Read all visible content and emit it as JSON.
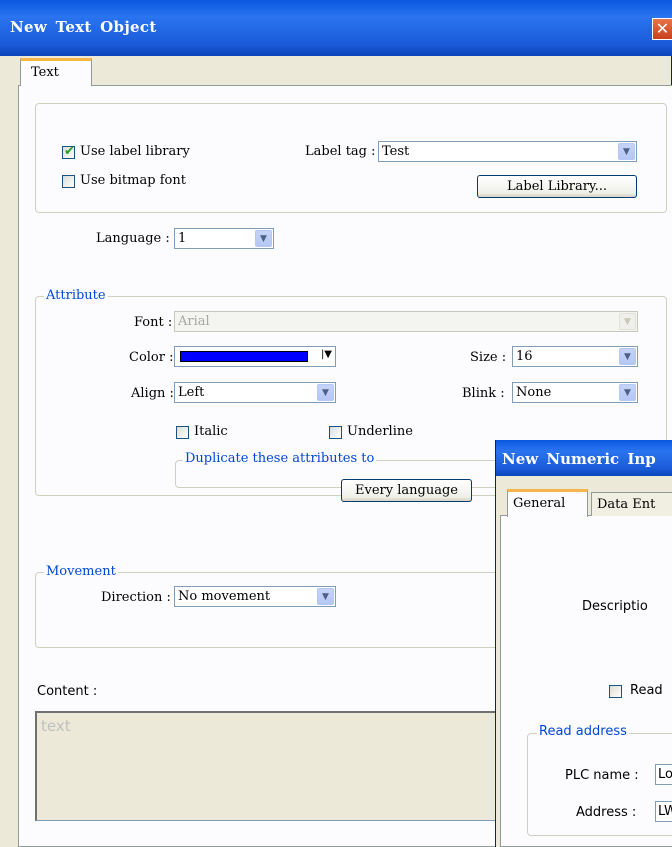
{
  "window": {
    "title": "New  Text Object",
    "close_glyph": "✕"
  },
  "tabs": [
    {
      "label": "Text"
    }
  ],
  "library": {
    "use_label_library": {
      "label": "Use label library",
      "checked": true
    },
    "use_bitmap_font": {
      "label": "Use bitmap font",
      "checked": false
    },
    "label_tag_label": "Label tag :",
    "label_tag_value": "Test",
    "label_library_button": "Label Library..."
  },
  "language": {
    "label": "Language :",
    "value": "1"
  },
  "attribute": {
    "group_label": "Attribute",
    "font_label": "Font :",
    "font_value": "Arial",
    "color_label": "Color :",
    "color_value": "#0000ff",
    "size_label": "Size :",
    "size_value": "16",
    "align_label": "Align :",
    "align_value": "Left",
    "blink_label": "Blink :",
    "blink_value": "None",
    "italic": {
      "label": "Italic",
      "checked": false
    },
    "underline": {
      "label": "Underline",
      "checked": false
    },
    "duplicate_group_label": "Duplicate these attributes to",
    "every_language_button": "Every language"
  },
  "movement": {
    "group_label": "Movement",
    "direction_label": "Direction :",
    "direction_value": "No movement"
  },
  "content": {
    "label": "Content :",
    "text": "text"
  },
  "numeric_window": {
    "title": "New  Numeric Inp",
    "tabs": [
      {
        "label": "General"
      },
      {
        "label": "Data Ent"
      }
    ],
    "description_label": "Descriptio",
    "read_only_label": "Read",
    "read_address_group_label": "Read address",
    "plc_name_label": "PLC name :",
    "plc_name_value": "Lo",
    "address_label": "Address :",
    "address_value": "LW"
  }
}
